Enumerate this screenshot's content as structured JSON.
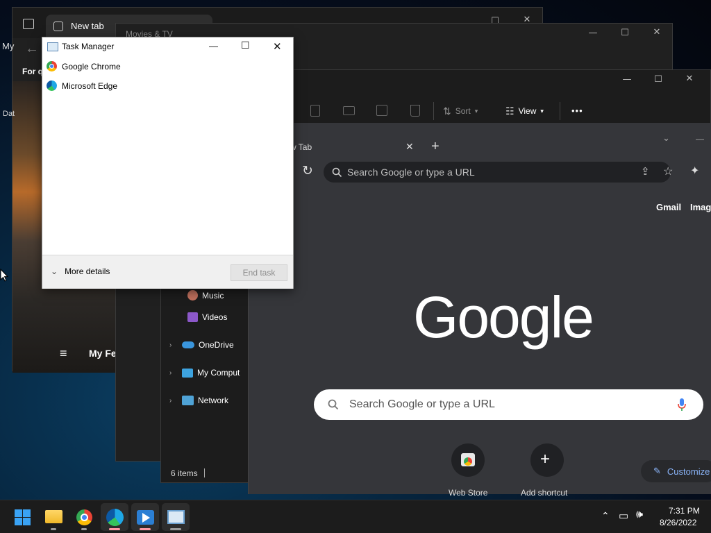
{
  "edge": {
    "tab_title": "New tab",
    "partial_label_left": "My",
    "for_label": "For q",
    "dat_label": "Dat",
    "feed_label": "My Fe"
  },
  "movies": {
    "title": "Movies & TV"
  },
  "explorer": {
    "toolbar": {
      "sort_label": "Sort",
      "view_label": "View",
      "more_label": "•••"
    },
    "nav_items": [
      "Music",
      "Videos",
      "OneDrive",
      "My Comput",
      "Network"
    ],
    "status": "6 items"
  },
  "chrome": {
    "tab_title": "w Tab",
    "omnibox_placeholder": "Search Google or type a URL",
    "gmail_link": "Gmail",
    "images_link": "Image",
    "logo_text": "Google",
    "search_placeholder": "Search Google or type a URL",
    "shortcuts": [
      "Web Store",
      "Add shortcut"
    ],
    "customize_label": "Customize"
  },
  "task_manager": {
    "title": "Task Manager",
    "apps": [
      "Google Chrome",
      "Microsoft Edge"
    ],
    "more_details": "More details",
    "end_task": "End task"
  },
  "taskbar": {
    "time": "7:31 PM",
    "date": "8/26/2022"
  },
  "colors": {
    "accent_pink": "#ff99a4",
    "chrome_bg": "#35363a",
    "customize_blue": "#8ab4f8"
  }
}
